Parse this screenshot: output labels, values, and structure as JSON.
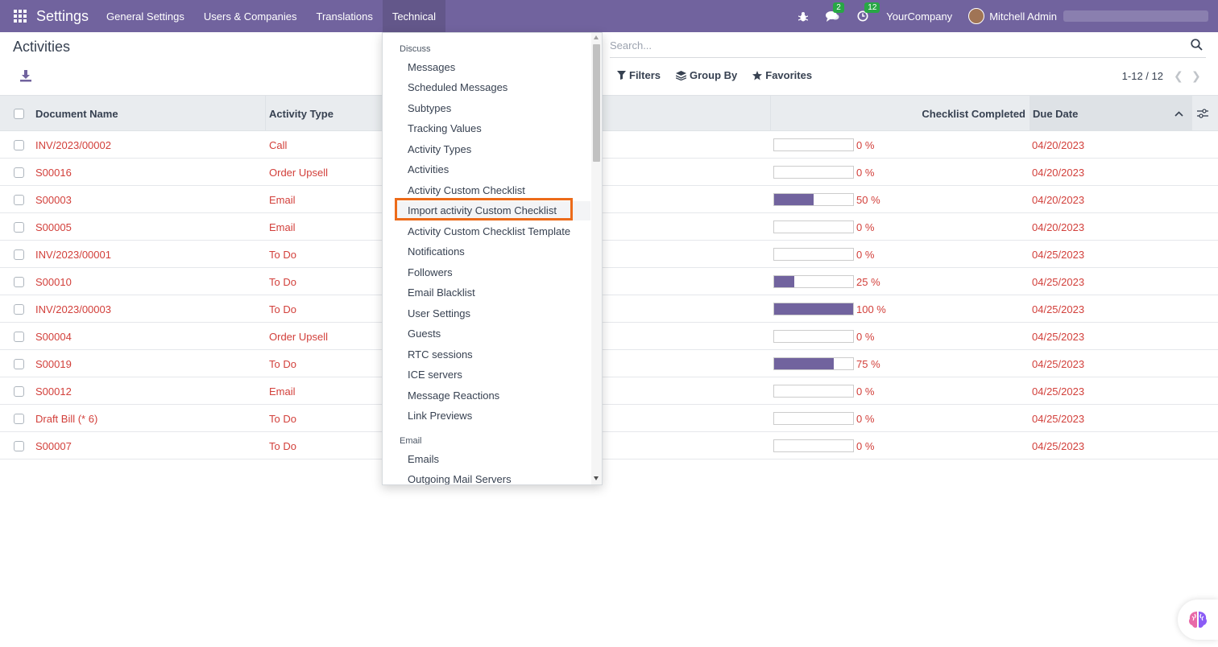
{
  "navbar": {
    "brand": "Settings",
    "menu": [
      {
        "label": "General Settings"
      },
      {
        "label": "Users & Companies"
      },
      {
        "label": "Translations"
      },
      {
        "label": "Technical"
      }
    ],
    "messages_count": "2",
    "activities_count": "12",
    "company": "YourCompany",
    "user": "Mitchell Admin",
    "accent": "#71639e"
  },
  "control_panel": {
    "title": "Activities",
    "search_placeholder": "Search...",
    "filters_label": "Filters",
    "group_by_label": "Group By",
    "favorites_label": "Favorites",
    "pager": "1-12 / 12"
  },
  "table": {
    "headers": {
      "document_name": "Document Name",
      "activity_type": "Activity Type",
      "checklist_completed": "Checklist Completed",
      "due_date": "Due Date"
    },
    "rows": [
      {
        "doc": "INV/2023/00002",
        "type": "Call",
        "pct_label": "0 %",
        "pct": 0,
        "due": "04/20/2023"
      },
      {
        "doc": "S00016",
        "type": "Order Upsell",
        "pct_label": "0 %",
        "pct": 0,
        "due": "04/20/2023"
      },
      {
        "doc": "S00003",
        "type": "Email",
        "pct_label": "50 %",
        "pct": 50,
        "due": "04/20/2023"
      },
      {
        "doc": "S00005",
        "type": "Email",
        "pct_label": "0 %",
        "pct": 0,
        "due": "04/20/2023"
      },
      {
        "doc": "INV/2023/00001",
        "type": "To Do",
        "pct_label": "0 %",
        "pct": 0,
        "due": "04/25/2023"
      },
      {
        "doc": "S00010",
        "type": "To Do",
        "pct_label": "25 %",
        "pct": 25,
        "due": "04/25/2023"
      },
      {
        "doc": "INV/2023/00003",
        "type": "To Do",
        "pct_label": "100 %",
        "pct": 100,
        "due": "04/25/2023"
      },
      {
        "doc": "S00004",
        "type": "Order Upsell",
        "pct_label": "0 %",
        "pct": 0,
        "due": "04/25/2023"
      },
      {
        "doc": "S00019",
        "type": "To Do",
        "pct_label": "75 %",
        "pct": 75,
        "due": "04/25/2023"
      },
      {
        "doc": "S00012",
        "type": "Email",
        "pct_label": "0 %",
        "pct": 0,
        "due": "04/25/2023"
      },
      {
        "doc": "Draft Bill (* 6)",
        "type": "To Do",
        "pct_label": "0 %",
        "pct": 0,
        "due": "04/25/2023"
      },
      {
        "doc": "S00007",
        "type": "To Do",
        "pct_label": "0 %",
        "pct": 0,
        "due": "04/25/2023"
      }
    ]
  },
  "technical_menu": {
    "section_discuss": "Discuss",
    "discuss_items": [
      "Messages",
      "Scheduled Messages",
      "Subtypes",
      "Tracking Values",
      "Activity Types",
      "Activities",
      "Activity Custom Checklist",
      "Import activity Custom Checklist",
      "Activity Custom Checklist Template",
      "Notifications",
      "Followers",
      "Email Blacklist",
      "User Settings",
      "Guests",
      "RTC sessions",
      "ICE servers",
      "Message Reactions",
      "Link Previews"
    ],
    "section_email": "Email",
    "email_items": [
      "Emails",
      "Outgoing Mail Servers"
    ],
    "highlighted_item": "Import activity Custom Checklist",
    "highlight_color": "#ec6b1a"
  }
}
